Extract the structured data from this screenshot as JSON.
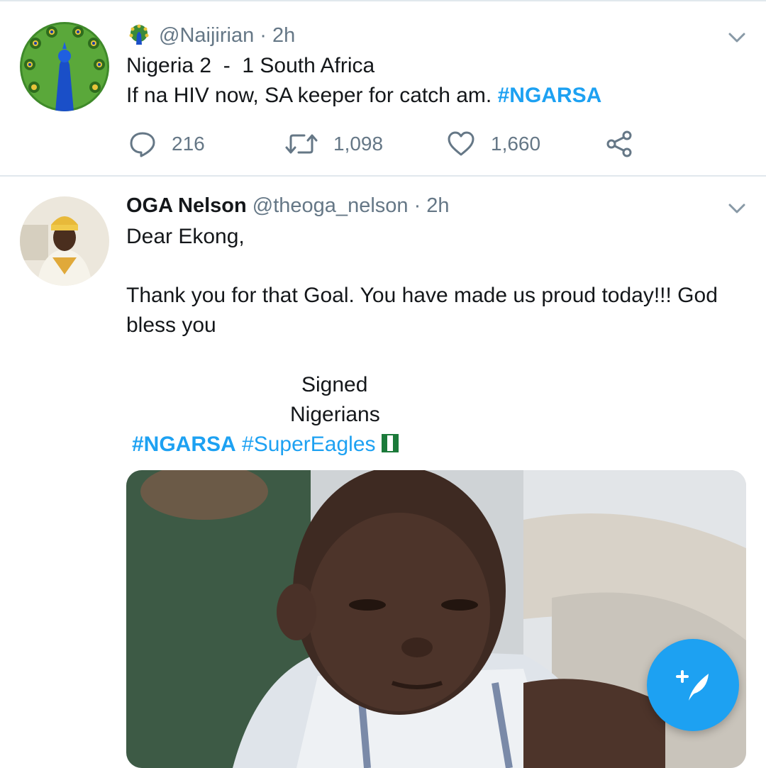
{
  "tweets": [
    {
      "handle": "@Naijirian",
      "time": "· 2h",
      "lines": [
        "Nigeria 2  -  1 South Africa",
        "If na HIV now, SA keeper for catch am. "
      ],
      "hashtag": "#NGARSA",
      "actions": {
        "replies": "216",
        "retweets": "1,098",
        "likes": "1,660"
      }
    },
    {
      "name": "OGA Nelson",
      "handle": "@theoga_nelson",
      "time": "· 2h",
      "lines": [
        "Dear Ekong,",
        "Thank you for that Goal. You have made us proud today!!! God",
        "bless you",
        "Signed",
        "Nigerians"
      ],
      "hashtags": [
        "#NGARSA",
        "#SuperEagles"
      ]
    }
  ],
  "icons": {
    "badge": "peacock-badge-icon",
    "menu": "chevron-down-icon",
    "reply": "reply-icon",
    "retweet": "retweet-icon",
    "like": "heart-icon",
    "share": "share-icon",
    "compose": "compose-tweet-icon",
    "flag": "nigeria-flag-icon"
  },
  "colors": {
    "accent": "#1da1f2",
    "muted": "#657786",
    "text": "#14171a",
    "divider": "#e1e8ed"
  }
}
